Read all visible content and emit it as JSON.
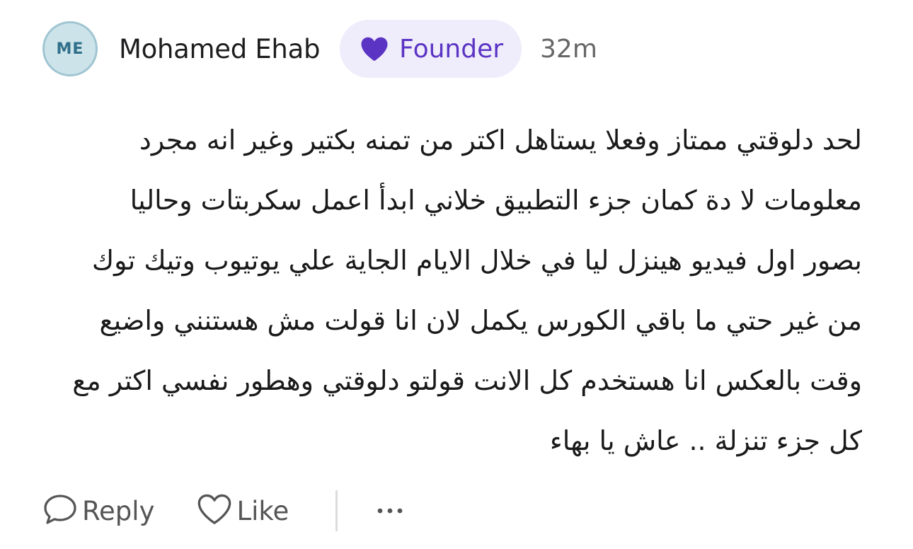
{
  "author": {
    "initials": "ME",
    "name": "Mohamed Ehab",
    "badge": "Founder",
    "timestamp": "32m"
  },
  "comment": {
    "lines": [
      "لحد دلوقتي ممتاز وفعلا يستاهل اكتر من تمنه بكتير وغير انه مجرد",
      "معلومات لا دة كمان جزء التطبيق خلاني ابدأ اعمل سكربتات وحاليا",
      "بصور اول فيديو هينزل ليا في خلال الايام الجاية علي يوتيوب وتيك توك",
      "من غير حتي ما باقي الكورس يكمل لان انا قولت مش هستنني واضيع",
      "وقت بالعكس انا هستخدم كل الانت قولتو دلوقتي وهطور نفسي اكتر مع",
      "كل جزء تنزلة .. عاش يا بهاء"
    ]
  },
  "actions": {
    "reply_label": "Reply",
    "like_label": "Like"
  },
  "icons": {
    "badge": "heart-icon",
    "reply": "speech-bubble-icon",
    "like": "heart-outline-icon",
    "more": "ellipsis-icon"
  },
  "colors": {
    "badge_bg": "#efecfb",
    "badge_accent": "#5b34c4",
    "avatar_bg": "#cde3ea",
    "avatar_text": "#2f6f8a"
  }
}
